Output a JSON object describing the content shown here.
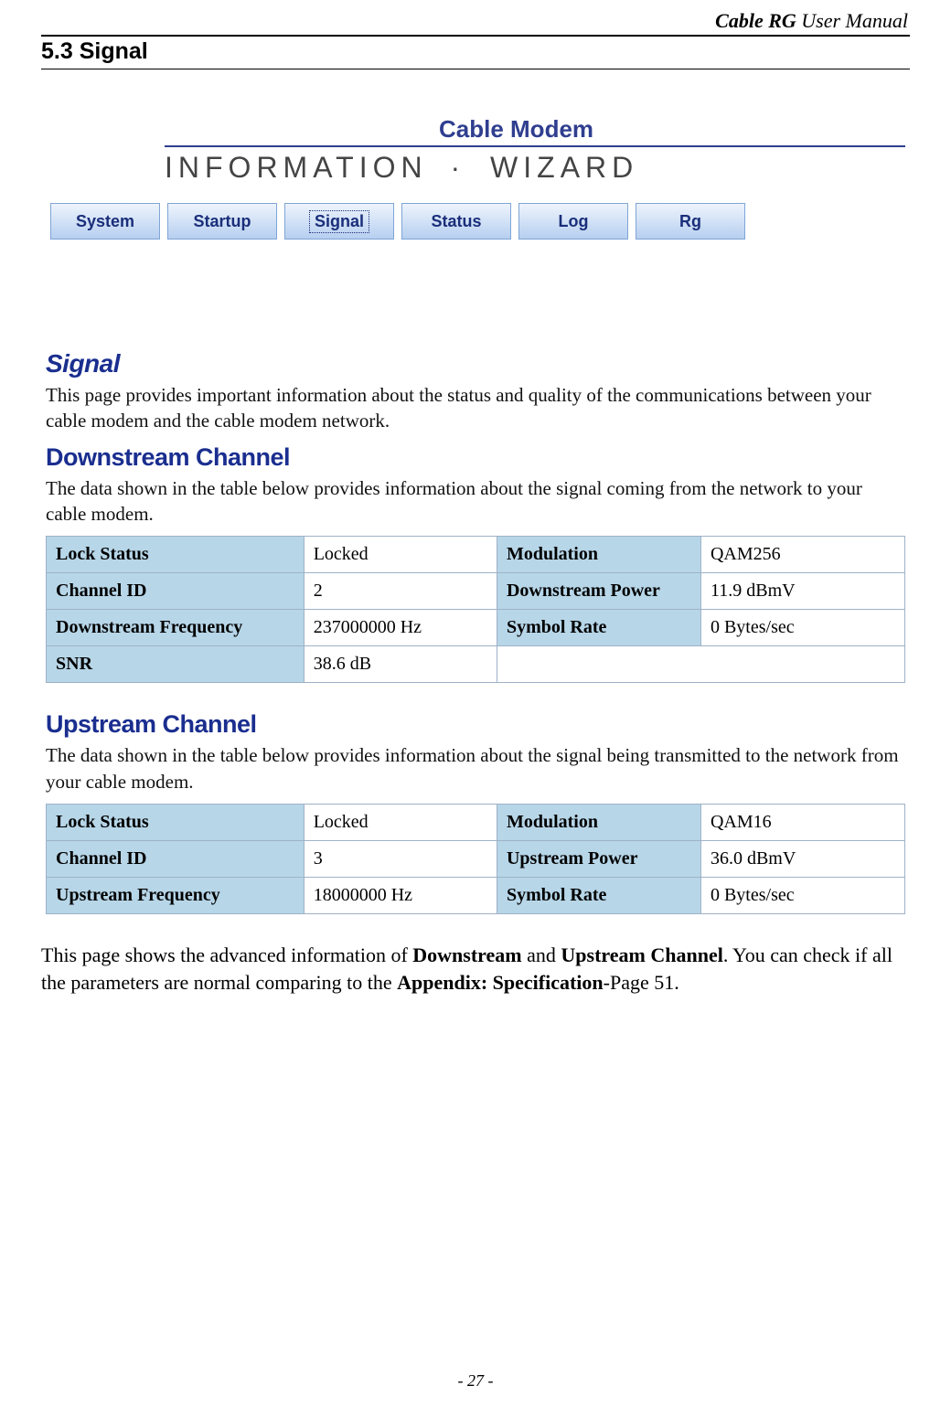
{
  "header": {
    "product": "Cable RG",
    "suffix": "User Manual"
  },
  "section": {
    "heading": "5.3 Signal"
  },
  "brand": {
    "top": "Cable Modem",
    "info": "INFORMATION",
    "dot": "·",
    "wizard": "WIZARD"
  },
  "tabs": [
    {
      "label": "System",
      "active": false
    },
    {
      "label": "Startup",
      "active": false
    },
    {
      "label": "Signal",
      "active": true
    },
    {
      "label": "Status",
      "active": false
    },
    {
      "label": "Log",
      "active": false
    },
    {
      "label": "Rg",
      "active": false
    }
  ],
  "panel": {
    "title": "Signal",
    "desc": "This page provides important information about the status and quality of the communications between your cable modem and the cable modem network."
  },
  "downstream": {
    "title": "Downstream Channel",
    "desc": "The data shown in the table below provides information about the signal coming from the network to your cable modem.",
    "rows": [
      {
        "l1": "Lock Status",
        "v1": "Locked",
        "l2": "Modulation",
        "v2": "QAM256"
      },
      {
        "l1": "Channel ID",
        "v1": "2",
        "l2": "Downstream Power",
        "v2": "11.9 dBmV"
      },
      {
        "l1": "Downstream Frequency",
        "v1": "237000000 Hz",
        "l2": "Symbol Rate",
        "v2": "0 Bytes/sec"
      },
      {
        "l1": "SNR",
        "v1": "38.6 dB",
        "l2": "",
        "v2": ""
      }
    ]
  },
  "upstream": {
    "title": "Upstream Channel",
    "desc": "The data shown in the table below provides information about the signal being transmitted to the network from your cable modem.",
    "rows": [
      {
        "l1": "Lock Status",
        "v1": "Locked",
        "l2": "Modulation",
        "v2": "QAM16"
      },
      {
        "l1": "Channel ID",
        "v1": "3",
        "l2": "Upstream Power",
        "v2": "36.0 dBmV"
      },
      {
        "l1": "Upstream Frequency",
        "v1": "18000000 Hz",
        "l2": "Symbol Rate",
        "v2": "0 Bytes/sec"
      }
    ]
  },
  "caption": {
    "t1": "This page shows the advanced information of ",
    "b1": "Downstream",
    "t2": " and ",
    "b2": "Upstream Channel",
    "t3": ". You can check if all the parameters are normal comparing to the ",
    "b3": "Appendix: Specification",
    "t4": "-Page 51."
  },
  "footer": {
    "page": "- 27 -"
  }
}
